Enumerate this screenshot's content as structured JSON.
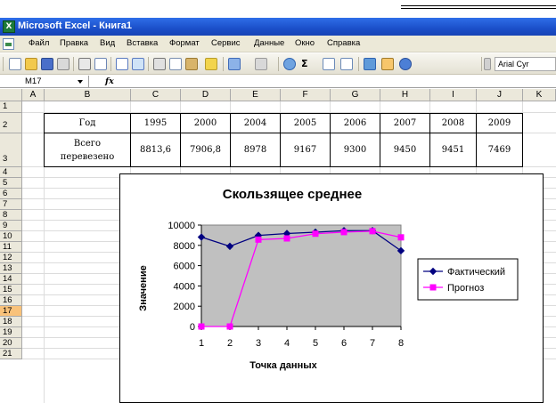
{
  "app": {
    "title": "Microsoft Excel - Книга1",
    "icon_label": "X"
  },
  "menu": [
    "Файл",
    "Правка",
    "Вид",
    "Вставка",
    "Формат",
    "Сервис",
    "Данные",
    "Окно",
    "Справка"
  ],
  "toolbar": {
    "font_name": "Arial Cyr",
    "sigma": "Σ",
    "icons": [
      "new-icon",
      "open-icon",
      "save-icon",
      "permission-icon",
      "print-icon",
      "print-preview-icon",
      "spelling-icon",
      "research-icon",
      "cut-icon",
      "copy-icon",
      "paste-icon",
      "format-painter-icon",
      "undo-icon",
      "redo-icon",
      "hyperlink-icon",
      "autosum-icon",
      "sort-asc-icon",
      "sort-desc-icon",
      "chart-wizard-icon",
      "drawing-icon",
      "help-icon"
    ]
  },
  "formula_bar": {
    "name_box": "M17",
    "fx": "fx",
    "formula": ""
  },
  "sheet": {
    "columns": [
      "A",
      "B",
      "C",
      "D",
      "E",
      "F",
      "G",
      "H",
      "I",
      "J",
      "K"
    ],
    "rows": [
      "1",
      "2",
      "3",
      "4",
      "5",
      "6",
      "7",
      "8",
      "9",
      "10",
      "11",
      "12",
      "13",
      "14",
      "15",
      "16",
      "17",
      "18",
      "19",
      "20",
      "21"
    ],
    "active_row": "17",
    "table": {
      "header_label": "Год",
      "years": [
        "1995",
        "2000",
        "2004",
        "2005",
        "2006",
        "2007",
        "2008",
        "2009"
      ],
      "row_label_1": "Всего",
      "row_label_2": "перевезено",
      "values": [
        "8813,6",
        "7906,8",
        "8978",
        "9167",
        "9300",
        "9450",
        "9451",
        "7469"
      ]
    }
  },
  "chart_data": {
    "type": "line",
    "title": "Скользящее среднее",
    "xlabel": "Точка данных",
    "ylabel": "Значение",
    "categories": [
      "1",
      "2",
      "3",
      "4",
      "5",
      "6",
      "7",
      "8"
    ],
    "x_ticks": [
      "1",
      "2",
      "3",
      "4",
      "5",
      "6",
      "7",
      "8"
    ],
    "y_ticks": [
      "0",
      "2000",
      "4000",
      "6000",
      "8000",
      "10000"
    ],
    "ylim": [
      0,
      10000
    ],
    "grid": false,
    "plot_background": "#c0c0c0",
    "legend_position": "right",
    "series": [
      {
        "name": "Фактический",
        "color": "#000080",
        "marker": "diamond",
        "values": [
          8813.6,
          7906.8,
          8978,
          9167,
          9300,
          9450,
          9451,
          7469
        ]
      },
      {
        "name": "Прогноз",
        "color": "#ff00ff",
        "marker": "square",
        "values": [
          0,
          0,
          8566,
          8684,
          9148,
          9306,
          9400,
          8790
        ]
      }
    ]
  }
}
